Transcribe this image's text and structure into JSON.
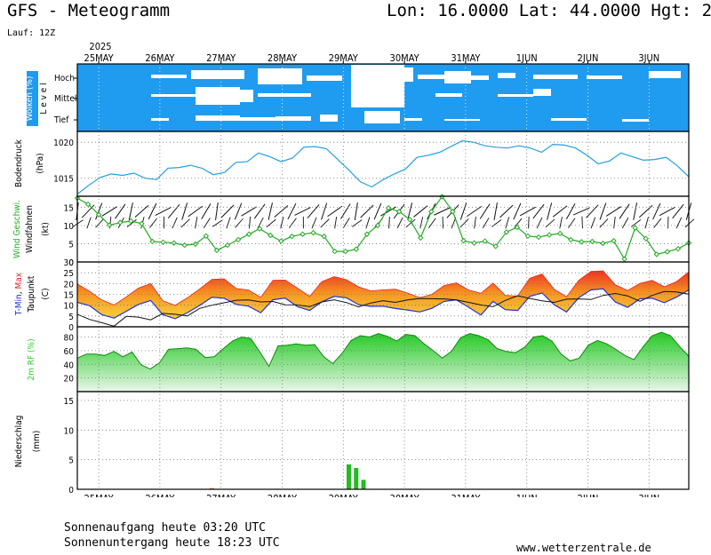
{
  "header": {
    "title": "GFS - Meteogramm",
    "coords": "Lon: 16.0000 Lat: 44.0000 Hgt: 2",
    "run": "Lauf: 12Z"
  },
  "footer": {
    "sunrise": "Sonnenaufgang heute 03:20 UTC",
    "sunset": "Sonnenuntergang heute 18:23 UTC",
    "site": "www.wetterzentrale.de"
  },
  "colors": {
    "cloud_bg": "#1f9bf0",
    "cloud": "#ffffff",
    "pressure": "#22a0e0",
    "wind": "#22aa22",
    "tmin": "#2233cc",
    "tmax": "#ee2222",
    "rh": "#33cc33",
    "precip": "#22bb22"
  },
  "chart_data": {
    "type": "meteogram",
    "x": {
      "top_labels": [
        "25MAY",
        "26MAY",
        "27MAY",
        "28MAY",
        "29MAY",
        "30MAY",
        "31MAY",
        "1JUN",
        "2JUN",
        "3JUN"
      ],
      "bottom_labels": [
        "25MAY",
        "26MAY",
        "27MAY",
        "28MAY",
        "29MAY",
        "30MAY",
        "31MAY",
        "1JUN",
        "2JUN",
        "3JUN"
      ],
      "year": "2025",
      "range_days": [
        0,
        10.0
      ]
    },
    "clouds": {
      "ylabel": "Wolken (%)",
      "side_label": "L e v e l",
      "levels": [
        "Hoch",
        "Mittel",
        "Tief"
      ]
    },
    "pressure": {
      "ylabel": "Bodendruck",
      "unit": "(hPa)",
      "ylim": [
        1012.5,
        1021.5
      ],
      "ticks": [
        1015,
        1020
      ],
      "values": [
        1012.8,
        1014.0,
        1015.1,
        1015.6,
        1015.4,
        1015.7,
        1015.0,
        1014.8,
        1016.4,
        1016.5,
        1016.8,
        1016.4,
        1015.5,
        1015.8,
        1017.2,
        1017.3,
        1018.5,
        1018.0,
        1017.3,
        1017.8,
        1019.3,
        1019.4,
        1019.1,
        1017.6,
        1016.1,
        1014.5,
        1013.8,
        1014.8,
        1015.6,
        1016.3,
        1017.9,
        1018.2,
        1018.6,
        1019.4,
        1020.2,
        1020.0,
        1019.5,
        1019.3,
        1019.2,
        1019.5,
        1019.2,
        1018.6,
        1019.7,
        1019.6,
        1019.2,
        1018.2,
        1017.0,
        1017.4,
        1018.5,
        1018.0,
        1017.5,
        1017.6,
        1017.9,
        1016.7,
        1015.2
      ]
    },
    "wind": {
      "ylabel": "Wind Geschwi.",
      "ylabel2": "Windfahnen",
      "unit": "(kt)",
      "ylim": [
        0,
        18
      ],
      "ticks": [
        0,
        5,
        10,
        15
      ],
      "values": [
        17.5,
        15.8,
        13.0,
        10.1,
        10.8,
        11.2,
        10.5,
        5.6,
        5.4,
        5.2,
        4.6,
        4.9,
        7.1,
        3.2,
        4.6,
        6.1,
        7.6,
        9.1,
        7.3,
        5.7,
        7.0,
        7.6,
        8.0,
        7.0,
        2.9,
        2.9,
        3.5,
        7.6,
        10.0,
        14.8,
        13.8,
        11.6,
        6.6,
        13.8,
        17.9,
        13.8,
        5.8,
        5.2,
        5.7,
        4.3,
        8.2,
        9.5,
        7.1,
        6.8,
        7.4,
        7.8,
        6.1,
        5.5,
        5.6,
        5.1,
        5.8,
        0.8,
        9.3,
        6.4,
        2.1,
        2.8,
        3.6,
        5.2
      ]
    },
    "temperature": {
      "ylabel_parts": [
        "T-Min",
        ", ",
        "Max"
      ],
      "ylabel2": "Taupunkt",
      "unit": "(C)",
      "ylim": [
        0,
        30
      ],
      "ticks": [
        0,
        5,
        10,
        15,
        20,
        25,
        30
      ],
      "tmax": [
        19.8,
        16.5,
        12.4,
        10.1,
        13.8,
        17.9,
        20.0,
        12.0,
        9.9,
        13.4,
        17.5,
        21.9,
        22.2,
        17.7,
        17.0,
        13.6,
        21.5,
        21.6,
        17.9,
        14.1,
        20.9,
        23.2,
        21.8,
        18.5,
        16.6,
        17.1,
        17.4,
        15.6,
        13.5,
        15.0,
        19.1,
        20.3,
        17.0,
        15.5,
        20.2,
        14.5,
        14.2,
        22.5,
        24.4,
        17.3,
        13.9,
        21.5,
        25.6,
        25.9,
        19.4,
        16.8,
        20.1,
        21.5,
        18.5,
        20.9,
        25.4
      ],
      "tmin": [
        17.1,
        15.5,
        11.4,
        9.8,
        12.9,
        16.1,
        17.9,
        11.3,
        9.5,
        12.3,
        15.6,
        19.4,
        19.0,
        16.1,
        15.3,
        12.3,
        18.3,
        19.0,
        15.1,
        13.3,
        17.3,
        19.8,
        19.2,
        16.0,
        15.2,
        15.3,
        14.2,
        13.5,
        12.6,
        14.3,
        17.5,
        18.2,
        14.8,
        11.2,
        17.5,
        13.7,
        13.3,
        19.8,
        21.4,
        15.9,
        12.6,
        19.2,
        22.8,
        23.3,
        17.2,
        14.7,
        18.7,
        19.0,
        16.9,
        19.5,
        22.8
      ],
      "dewpoint": [
        5.8,
        3.4,
        1.9,
        0.3,
        4.8,
        4.5,
        3.2,
        6.2,
        5.8,
        5.0,
        8.5,
        10.0,
        11.1,
        12.3,
        12.4,
        11.5,
        11.7,
        10.2,
        10.1,
        9.3,
        11.5,
        12.5,
        11.2,
        9.2,
        11.0,
        12.1,
        11.3,
        12.4,
        13.1,
        13.0,
        12.9,
        12.4,
        11.3,
        10.1,
        9.3,
        12.2,
        14.4,
        13.1,
        12.0,
        11.3,
        12.8,
        12.9,
        12.6,
        14.5,
        15.4,
        14.3,
        11.8,
        14.5,
        16.3,
        16.1,
        15.1
      ]
    },
    "humidity": {
      "ylabel": "2m RF (%)",
      "ylim": [
        0,
        95
      ],
      "ticks": [
        20,
        40,
        60,
        80
      ],
      "values": [
        49,
        55,
        55,
        53,
        59,
        51,
        58,
        39,
        33,
        42,
        62,
        63,
        64,
        62,
        50,
        51,
        63,
        74,
        80,
        78,
        58,
        37,
        67,
        68,
        70,
        68,
        69,
        51,
        41,
        56,
        75,
        82,
        80,
        85,
        81,
        74,
        84,
        82,
        70,
        60,
        49,
        59,
        79,
        85,
        82,
        76,
        63,
        59,
        57,
        65,
        80,
        82,
        74,
        55,
        45,
        49,
        68,
        75,
        70,
        62,
        53,
        47,
        66,
        82,
        87,
        82,
        66,
        52
      ]
    },
    "precipitation": {
      "ylabel": "Niederschlag",
      "unit": "(mm)",
      "ylim": [
        0,
        16.5
      ],
      "ticks": [
        0,
        5,
        10,
        15
      ],
      "bars": [
        {
          "day": 2.2,
          "value": 0.2,
          "color": "#ee7733"
        },
        {
          "day": 4.44,
          "value": 4.2,
          "color": "#22bb22"
        },
        {
          "day": 4.56,
          "value": 3.6,
          "color": "#22bb22"
        },
        {
          "day": 4.68,
          "value": 1.6,
          "color": "#22bb22"
        }
      ]
    }
  }
}
